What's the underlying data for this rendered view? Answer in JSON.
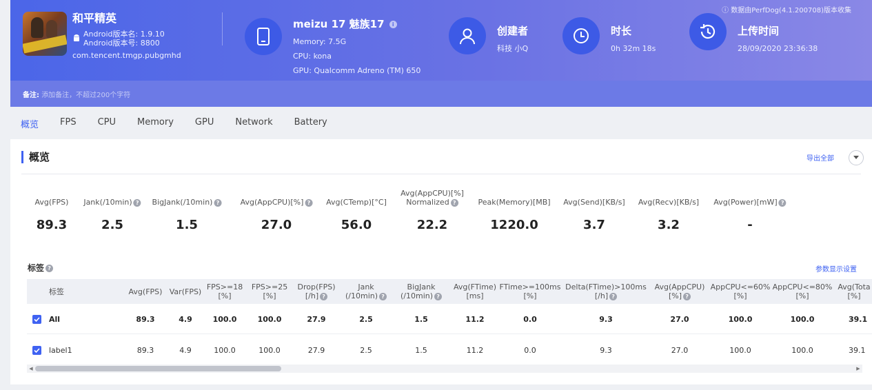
{
  "header": {
    "note_top": "ⓘ 数据由PerfDog(4.1.200708)版本收集",
    "app": {
      "name": "和平精英",
      "android_version_name": "Android版本名: 1.9.10",
      "android_version_code": "Android版本号: 8800",
      "package": "com.tencent.tmgp.pubgmhd"
    },
    "device": {
      "title": "meizu 17 魅族17",
      "memory": "Memory: 7.5G",
      "cpu": "CPU: kona",
      "gpu": "GPU: Qualcomm Adreno (TM) 650"
    },
    "creator": {
      "title": "创建者",
      "value": "科技 小Q"
    },
    "duration": {
      "title": "时长",
      "value": "0h 32m 18s"
    },
    "upload": {
      "title": "上传时间",
      "value": "28/09/2020 23:36:38"
    },
    "note": {
      "label": "备注:",
      "placeholder": "添加备注，不超过200个字符"
    }
  },
  "tabs": [
    {
      "label": "概览",
      "active": true
    },
    {
      "label": "FPS"
    },
    {
      "label": "CPU"
    },
    {
      "label": "Memory"
    },
    {
      "label": "GPU"
    },
    {
      "label": "Network"
    },
    {
      "label": "Battery"
    }
  ],
  "overview": {
    "title": "概览",
    "export_label": "导出全部",
    "stats": [
      {
        "label": "Avg(FPS)",
        "value": "89.3"
      },
      {
        "label": "Jank(/10min)",
        "value": "2.5",
        "help": true
      },
      {
        "label": "BigJank(/10min)",
        "value": "1.5",
        "help": true
      },
      {
        "label": "Avg(AppCPU)[%]",
        "value": "27.0",
        "help": true
      },
      {
        "label": "Avg(CTemp)[°C]",
        "value": "56.0"
      },
      {
        "label": "Avg(AppCPU)[%]",
        "label2": "Normalized",
        "value": "22.2",
        "help": true
      },
      {
        "label": "Peak(Memory)[MB]",
        "value": "1220.0"
      },
      {
        "label": "Avg(Send)[KB/s]",
        "value": "3.7"
      },
      {
        "label": "Avg(Recv)[KB/s]",
        "value": "3.2"
      },
      {
        "label": "Avg(Power)[mW]",
        "value": "-",
        "help": true
      }
    ]
  },
  "labels_section": {
    "title": "标签",
    "param_link": "参数显示设置",
    "columns": [
      {
        "l1": "标签"
      },
      {
        "l1": "Avg(FPS)"
      },
      {
        "l1": "Var(FPS)"
      },
      {
        "l1": "FPS>=18",
        "l2": "[%]"
      },
      {
        "l1": "FPS>=25",
        "l2": "[%]"
      },
      {
        "l1": "Drop(FPS)",
        "l2": "[/h]",
        "help": true
      },
      {
        "l1": "Jank",
        "l2": "(/10min)",
        "help": true
      },
      {
        "l1": "BigJank",
        "l2": "(/10min)",
        "help": true
      },
      {
        "l1": "Avg(FTime)",
        "l2": "[ms]"
      },
      {
        "l1": "FTime>=100ms",
        "l2": "[%]"
      },
      {
        "l1": "Delta(FTime)>100ms",
        "l2": "[/h]",
        "help": true
      },
      {
        "l1": "Avg(AppCPU)",
        "l2": "[%]",
        "help": true
      },
      {
        "l1": "AppCPU<=60%",
        "l2": "[%]"
      },
      {
        "l1": "AppCPU<=80%",
        "l2": "[%]"
      },
      {
        "l1": "Avg(Tota",
        "l2": "[%]"
      }
    ],
    "rows": [
      {
        "name": "All",
        "bold": true,
        "values": [
          "89.3",
          "4.9",
          "100.0",
          "100.0",
          "27.9",
          "2.5",
          "1.5",
          "11.2",
          "0.0",
          "9.3",
          "27.0",
          "100.0",
          "100.0",
          "39.1"
        ]
      },
      {
        "name": "label1",
        "bold": false,
        "values": [
          "89.3",
          "4.9",
          "100.0",
          "100.0",
          "27.9",
          "2.5",
          "1.5",
          "11.2",
          "0.0",
          "9.3",
          "27.0",
          "100.0",
          "100.0",
          "39.1"
        ]
      }
    ]
  },
  "colors": {
    "accent": "#3f62f2",
    "header_start": "#4b66e8",
    "header_end": "#8a88e6"
  }
}
